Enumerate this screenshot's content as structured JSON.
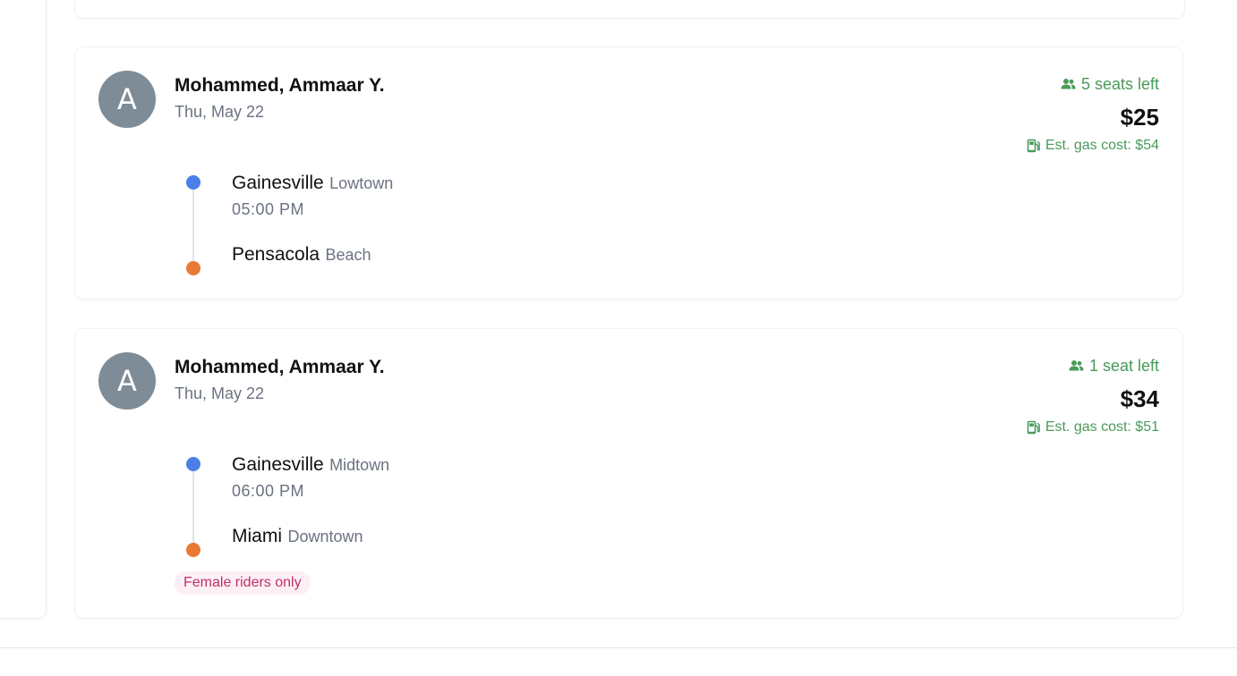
{
  "rides": [
    {
      "avatar_initial": "A",
      "driver_name": "Mohammed, Ammaar Y.",
      "date": "Thu, May 22",
      "seats_left": "5 seats left",
      "price": "$25",
      "gas_cost": "Est. gas cost: $54",
      "origin": {
        "city": "Gainesville",
        "area": "Lowtown",
        "time": "05:00 PM"
      },
      "destination": {
        "city": "Pensacola",
        "area": "Beach"
      }
    },
    {
      "avatar_initial": "A",
      "driver_name": "Mohammed, Ammaar Y.",
      "date": "Thu, May 22",
      "seats_left": "1 seat left",
      "price": "$34",
      "gas_cost": "Est. gas cost: $51",
      "origin": {
        "city": "Gainesville",
        "area": "Midtown",
        "time": "06:00 PM"
      },
      "destination": {
        "city": "Miami",
        "area": "Downtown"
      },
      "tag": "Female riders only"
    }
  ],
  "icons": {
    "seats": "people-icon",
    "gas": "gas-pump-icon"
  },
  "colors": {
    "accent_green": "#4a9a5a",
    "origin_dot": "#4a7fe8",
    "destination_dot": "#e87a35",
    "avatar_bg": "#7e8c98",
    "tag_text": "#c0306b",
    "tag_bg": "#fdf0f5"
  }
}
